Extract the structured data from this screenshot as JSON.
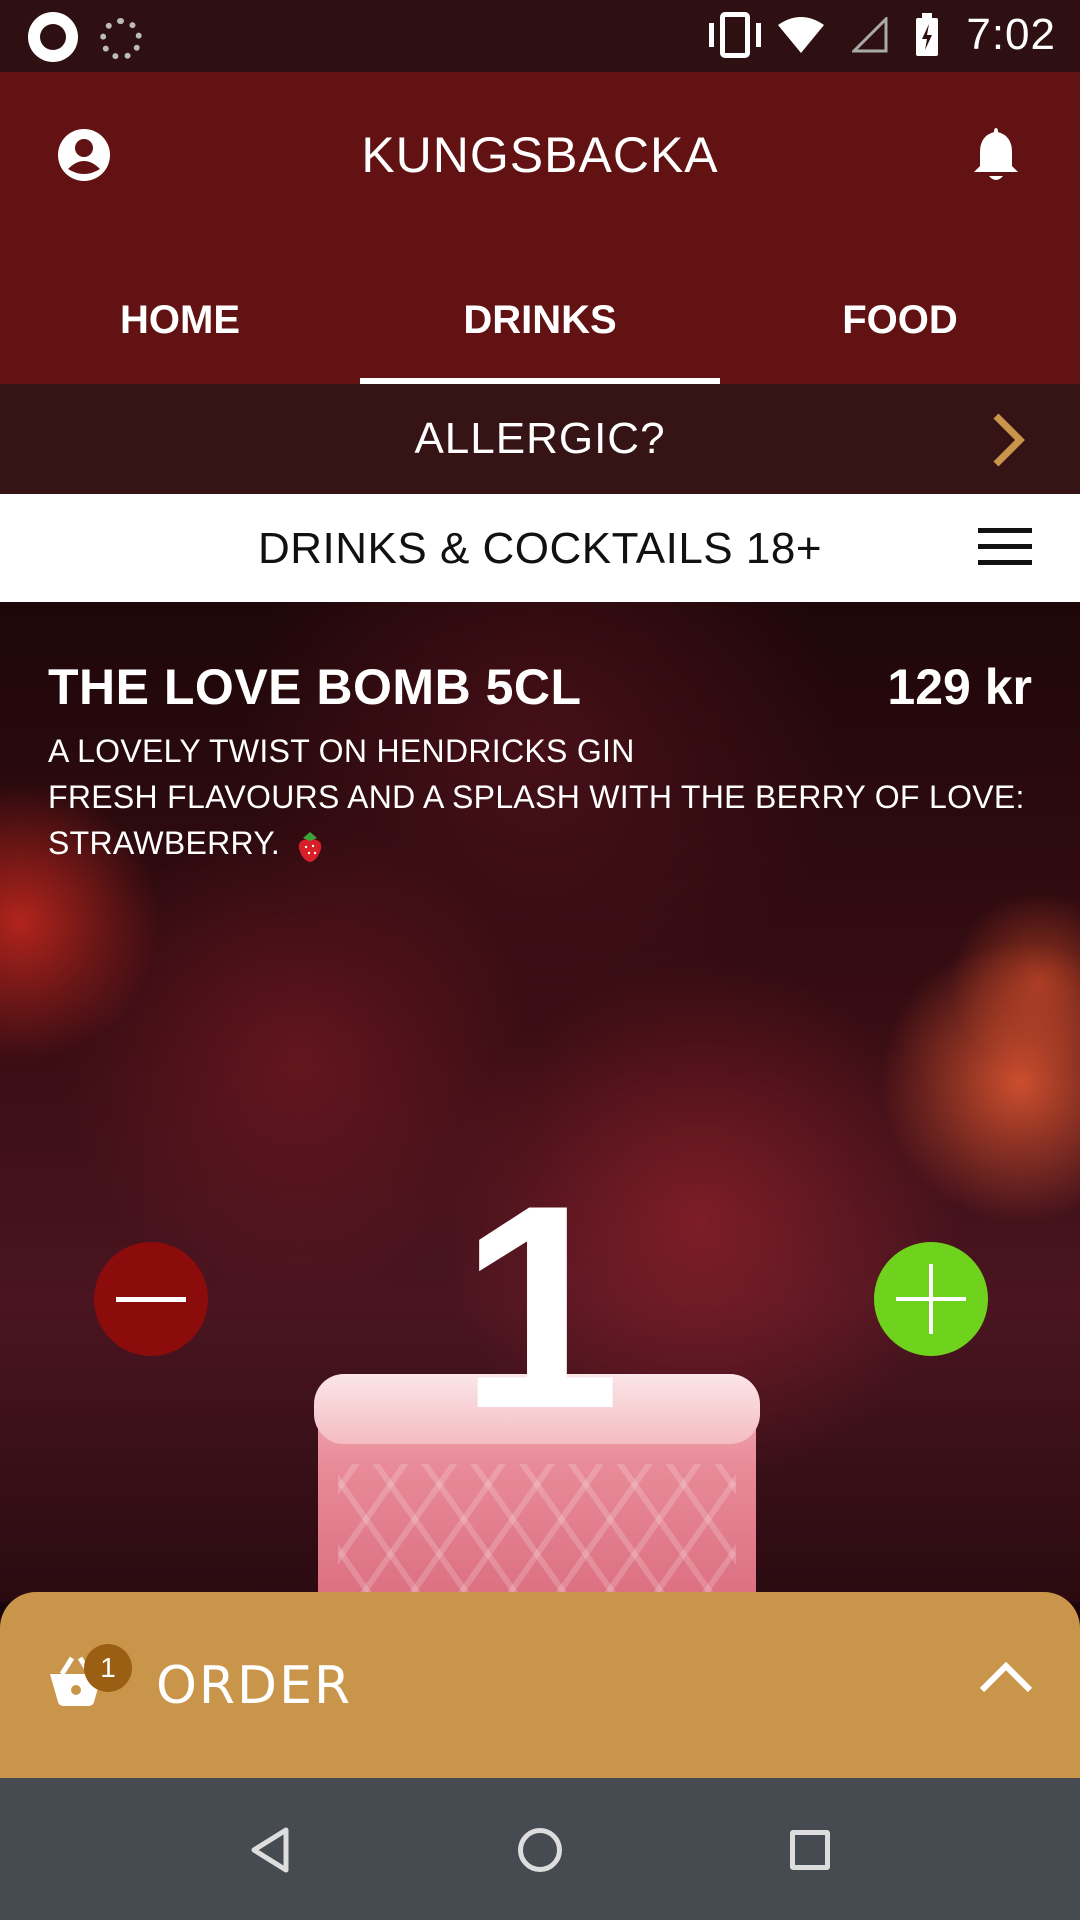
{
  "status_bar": {
    "time": "7:02",
    "left_icons": [
      "app-icon",
      "loader-icon"
    ],
    "right_icons": [
      "vibrate-icon",
      "wifi-icon",
      "signal-icon",
      "battery-icon"
    ]
  },
  "header": {
    "title": "KUNGSBACKA",
    "left_icon": "profile-icon",
    "right_icon": "bell-icon"
  },
  "tabs": [
    {
      "label": "HOME",
      "active": false
    },
    {
      "label": "DRINKS",
      "active": true
    },
    {
      "label": "FOOD",
      "active": false
    }
  ],
  "allergic": {
    "label": "ALLERGIC?",
    "icon": "chevron-right-icon"
  },
  "category": {
    "title": "DRINKS & COCKTAILS 18+",
    "icon": "menu-icon"
  },
  "product": {
    "name": "THE LOVE BOMB 5CL",
    "price": "129 kr",
    "description_line1": "A LOVELY TWIST ON HENDRICKS GIN",
    "description_line2": "FRESH FLAVOURS AND A SPLASH WITH THE BERRY OF LOVE:",
    "description_line3": "STRAWBERRY.",
    "description_icon": "strawberry-icon",
    "quantity": "1"
  },
  "order_bar": {
    "label": "ORDER",
    "badge_count": "1",
    "icon": "basket-icon",
    "toggle_icon": "chevron-up-icon"
  },
  "colors": {
    "header_bg": "#621212",
    "allergic_bg": "#361315",
    "minus_button": "#8c0b0b",
    "plus_button": "#6fd21c",
    "order_bar": "#c9954a",
    "chevron_accent": "#c9954a"
  },
  "nav_bar": {
    "icons": [
      "back-icon",
      "home-icon",
      "recents-icon"
    ]
  }
}
